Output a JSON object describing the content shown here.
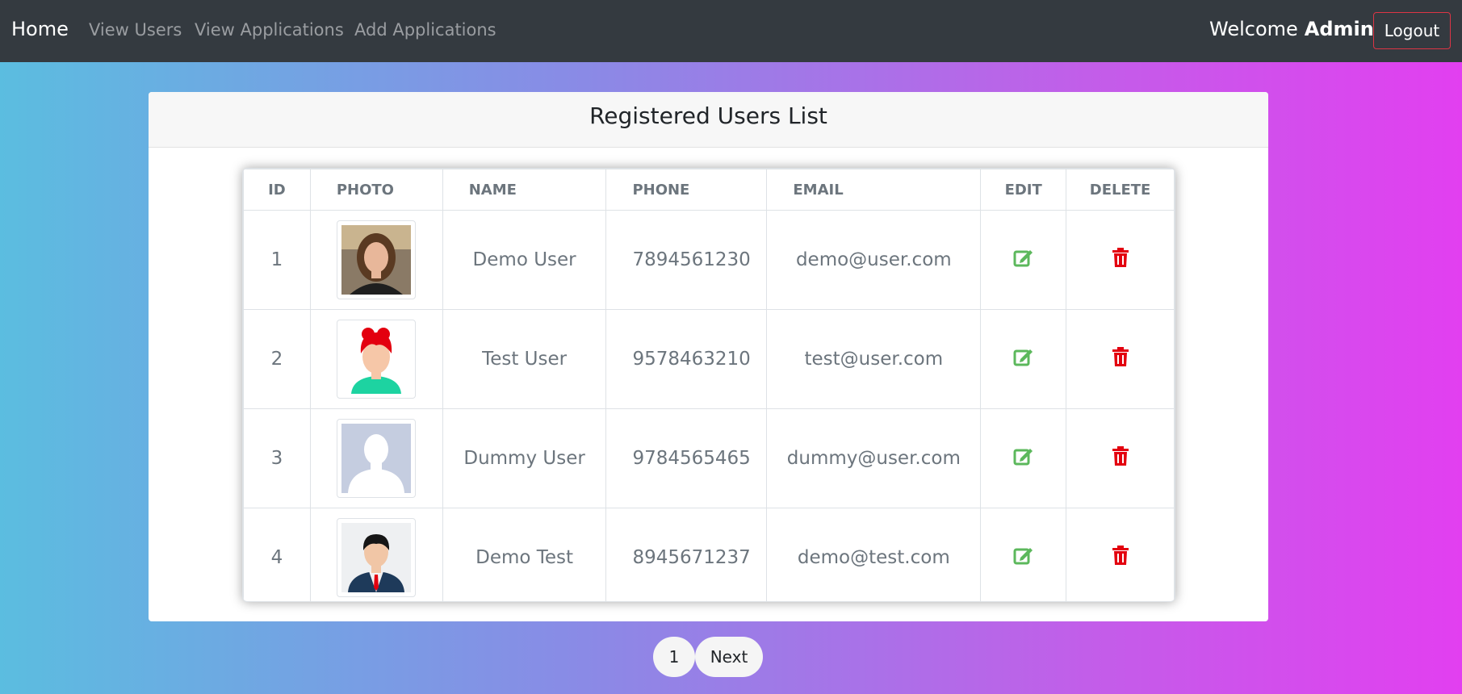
{
  "nav": {
    "brand": "Home",
    "links": [
      "View Users",
      "View Applications",
      "Add Applications"
    ],
    "welcome": "Welcome",
    "user": "Admin",
    "logout": "Logout"
  },
  "card": {
    "title": "Registered Users List"
  },
  "table": {
    "columns": [
      "ID",
      "PHOTO",
      "NAME",
      "PHONE",
      "EMAIL",
      "EDIT",
      "DELETE"
    ],
    "rows": [
      {
        "id": "1",
        "name": "Demo User",
        "phone": "7894561230",
        "email": "demo@user.com",
        "photo": "woman-photo"
      },
      {
        "id": "2",
        "name": "Test User",
        "phone": "9578463210",
        "email": "test@user.com",
        "photo": "red-hair-avatar"
      },
      {
        "id": "3",
        "name": "Dummy User",
        "phone": "9784565465",
        "email": "dummy@user.com",
        "photo": "default-silhouette"
      },
      {
        "id": "4",
        "name": "Demo Test",
        "phone": "8945671237",
        "email": "demo@test.com",
        "photo": "businessman-avatar"
      }
    ]
  },
  "pagination": {
    "page": "1",
    "next": "Next"
  },
  "colors": {
    "edit": "#5cb85c",
    "delete": "#e3000f",
    "navbar": "#343a40"
  }
}
